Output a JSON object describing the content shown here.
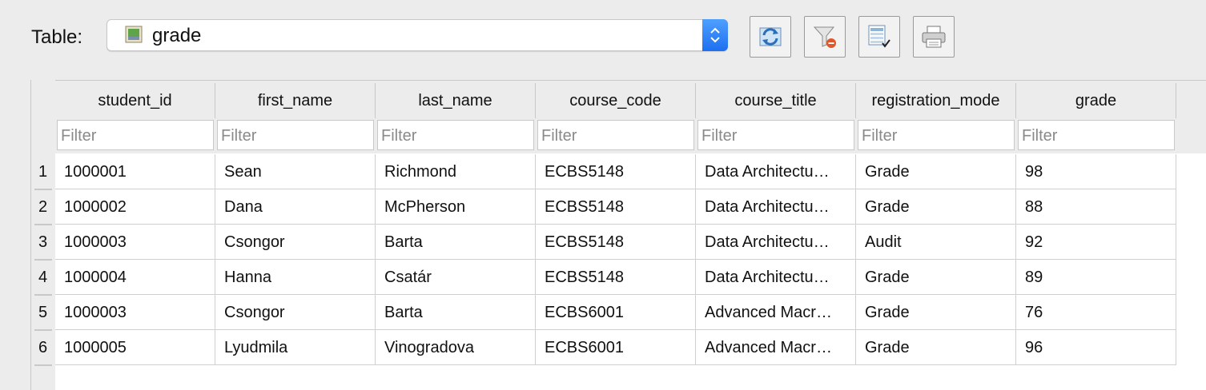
{
  "toolbar": {
    "table_label": "Table:",
    "selected_table": "grade",
    "buttons": [
      "refresh-icon",
      "clear-filter-icon",
      "export-icon",
      "print-icon"
    ]
  },
  "grid": {
    "columns": [
      "student_id",
      "first_name",
      "last_name",
      "course_code",
      "course_title",
      "registration_mode",
      "grade"
    ],
    "filter_placeholder": "Filter",
    "rows": [
      {
        "num": "1",
        "cells": [
          "1000001",
          "Sean",
          "Richmond",
          "ECBS5148",
          "Data Architectu…",
          "Grade",
          "98"
        ]
      },
      {
        "num": "2",
        "cells": [
          "1000002",
          "Dana",
          "McPherson",
          "ECBS5148",
          "Data Architectu…",
          "Grade",
          "88"
        ]
      },
      {
        "num": "3",
        "cells": [
          "1000003",
          "Csongor",
          "Barta",
          "ECBS5148",
          "Data Architectu…",
          "Audit",
          "92"
        ]
      },
      {
        "num": "4",
        "cells": [
          "1000004",
          "Hanna",
          "Csatár",
          "ECBS5148",
          "Data Architectu…",
          "Grade",
          "89"
        ]
      },
      {
        "num": "5",
        "cells": [
          "1000003",
          "Csongor",
          "Barta",
          "ECBS6001",
          "Advanced Macr…",
          "Grade",
          "76"
        ]
      },
      {
        "num": "6",
        "cells": [
          "1000005",
          "Lyudmila",
          "Vinogradova",
          "ECBS6001",
          "Advanced Macr…",
          "Grade",
          "96"
        ]
      }
    ]
  },
  "colors": {
    "accent": "#1e6ff0",
    "background": "#ececec",
    "grid_line": "#cfcfcf"
  }
}
